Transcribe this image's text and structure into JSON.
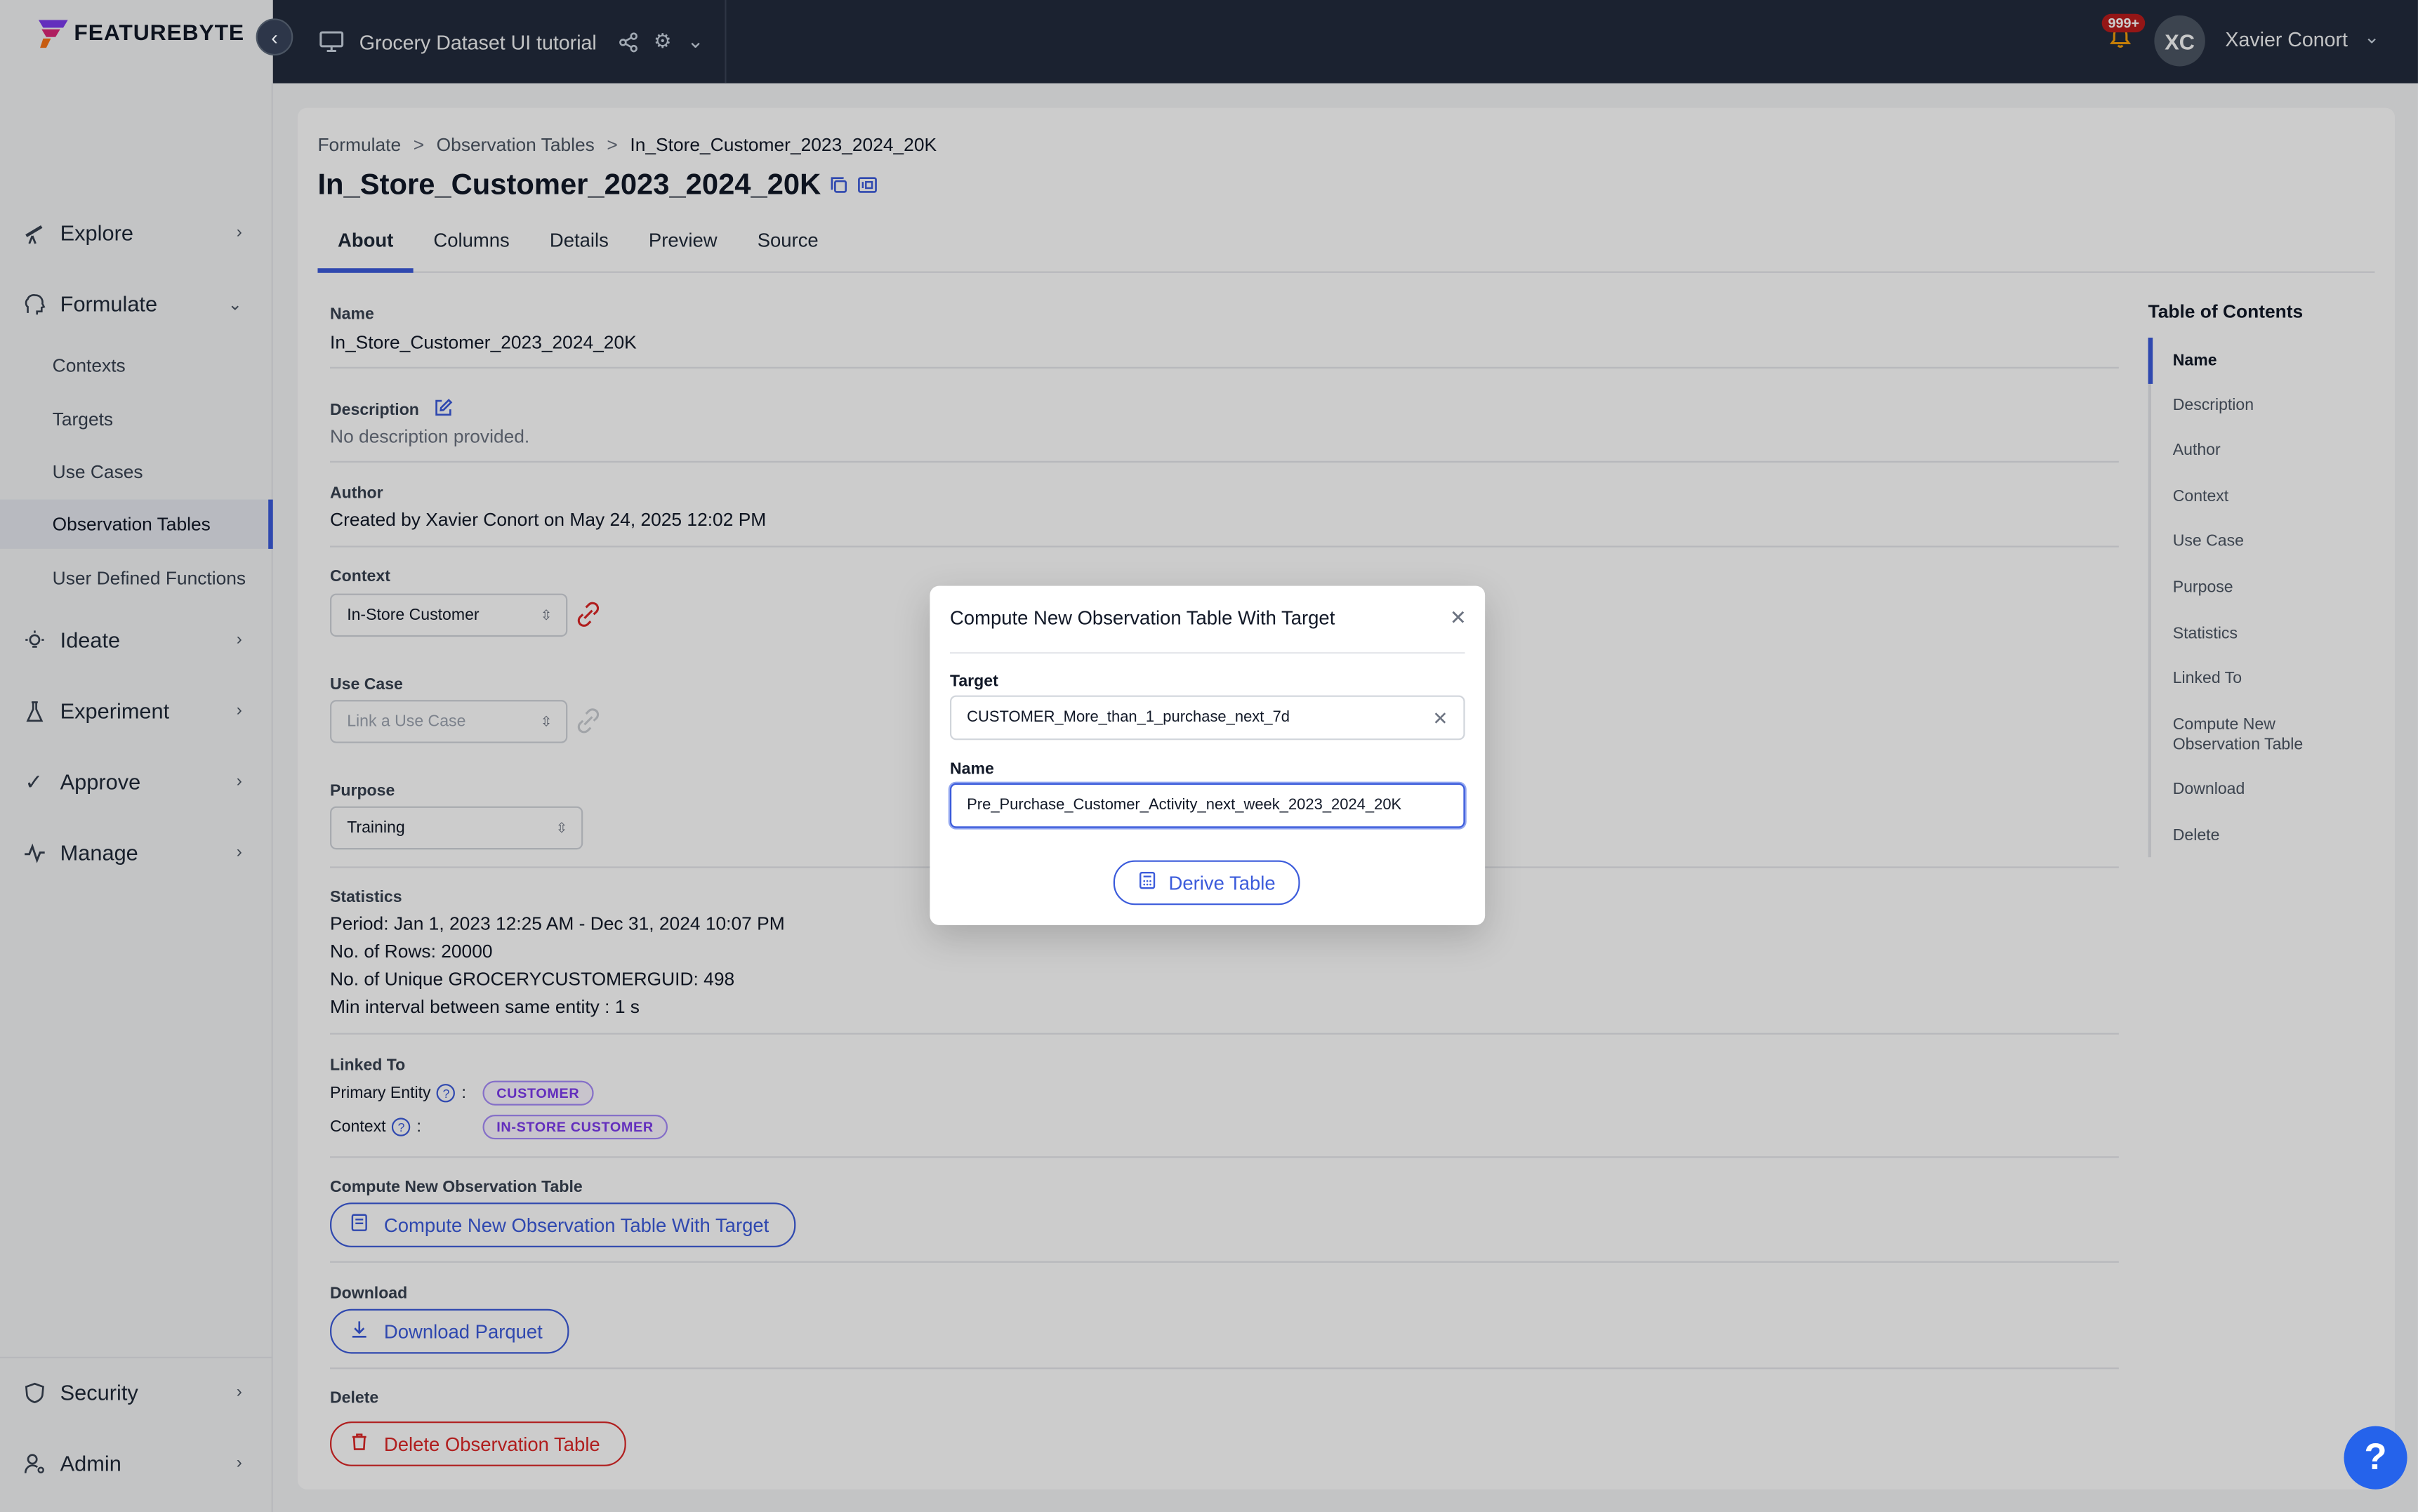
{
  "app": {
    "brand": "FEATUREBYTE",
    "project_title": "Grocery Dataset UI tutorial",
    "notification_count": "999+",
    "user_initials": "XC",
    "user_name": "Xavier Conort"
  },
  "sidebar": {
    "explore": "Explore",
    "formulate": "Formulate",
    "formulate_items": [
      "Contexts",
      "Targets",
      "Use Cases",
      "Observation Tables",
      "User Defined Functions"
    ],
    "ideate": "Ideate",
    "experiment": "Experiment",
    "approve": "Approve",
    "manage": "Manage",
    "security": "Security",
    "admin": "Admin"
  },
  "breadcrumb": [
    "Formulate",
    "Observation Tables",
    "In_Store_Customer_2023_2024_20K"
  ],
  "breadcrumb_sep": ">",
  "page_title": "In_Store_Customer_2023_2024_20K",
  "tabs": [
    "About",
    "Columns",
    "Details",
    "Preview",
    "Source"
  ],
  "about": {
    "name_label": "Name",
    "name_value": "In_Store_Customer_2023_2024_20K",
    "description_label": "Description",
    "description_value": "No description provided.",
    "author_label": "Author",
    "author_value": "Created by Xavier Conort on May 24, 2025 12:02 PM",
    "context_label": "Context",
    "context_value": "In-Store Customer",
    "use_case_label": "Use Case",
    "use_case_placeholder": "Link a Use Case",
    "purpose_label": "Purpose",
    "purpose_value": "Training",
    "statistics_label": "Statistics",
    "stats": [
      "Period: Jan 1, 2023 12:25 AM - Dec 31, 2024 10:07 PM",
      "No. of Rows: 20000",
      "No. of Unique GROCERYCUSTOMERGUID: 498",
      "Min interval between same entity : 1 s"
    ],
    "linked_to_label": "Linked To",
    "primary_entity_label": "Primary Entity",
    "primary_entity_tag": "CUSTOMER",
    "context_link_label": "Context",
    "context_tag": "IN-STORE CUSTOMER",
    "colon": ":",
    "compute_label": "Compute New Observation Table",
    "compute_button": "Compute New Observation Table With Target",
    "download_label": "Download",
    "download_button": "Download Parquet",
    "delete_label": "Delete",
    "delete_button": "Delete Observation Table"
  },
  "toc": {
    "title": "Table of Contents",
    "items": [
      "Name",
      "Description",
      "Author",
      "Context",
      "Use Case",
      "Purpose",
      "Statistics",
      "Linked To",
      "Compute New Observation Table",
      "Download",
      "Delete"
    ]
  },
  "modal": {
    "title": "Compute New Observation Table With Target",
    "target_label": "Target",
    "target_value": "CUSTOMER_More_than_1_purchase_next_7d",
    "name_label": "Name",
    "name_value": "Pre_Purchase_Customer_Activity_next_week_2023_2024_20K",
    "derive_button": "Derive Table"
  },
  "help_fab": "?",
  "colors": {
    "accent": "#3b5bdb",
    "header_bg": "#222b3d",
    "danger": "#dc2626",
    "tag_purple": "#7c3aed"
  }
}
